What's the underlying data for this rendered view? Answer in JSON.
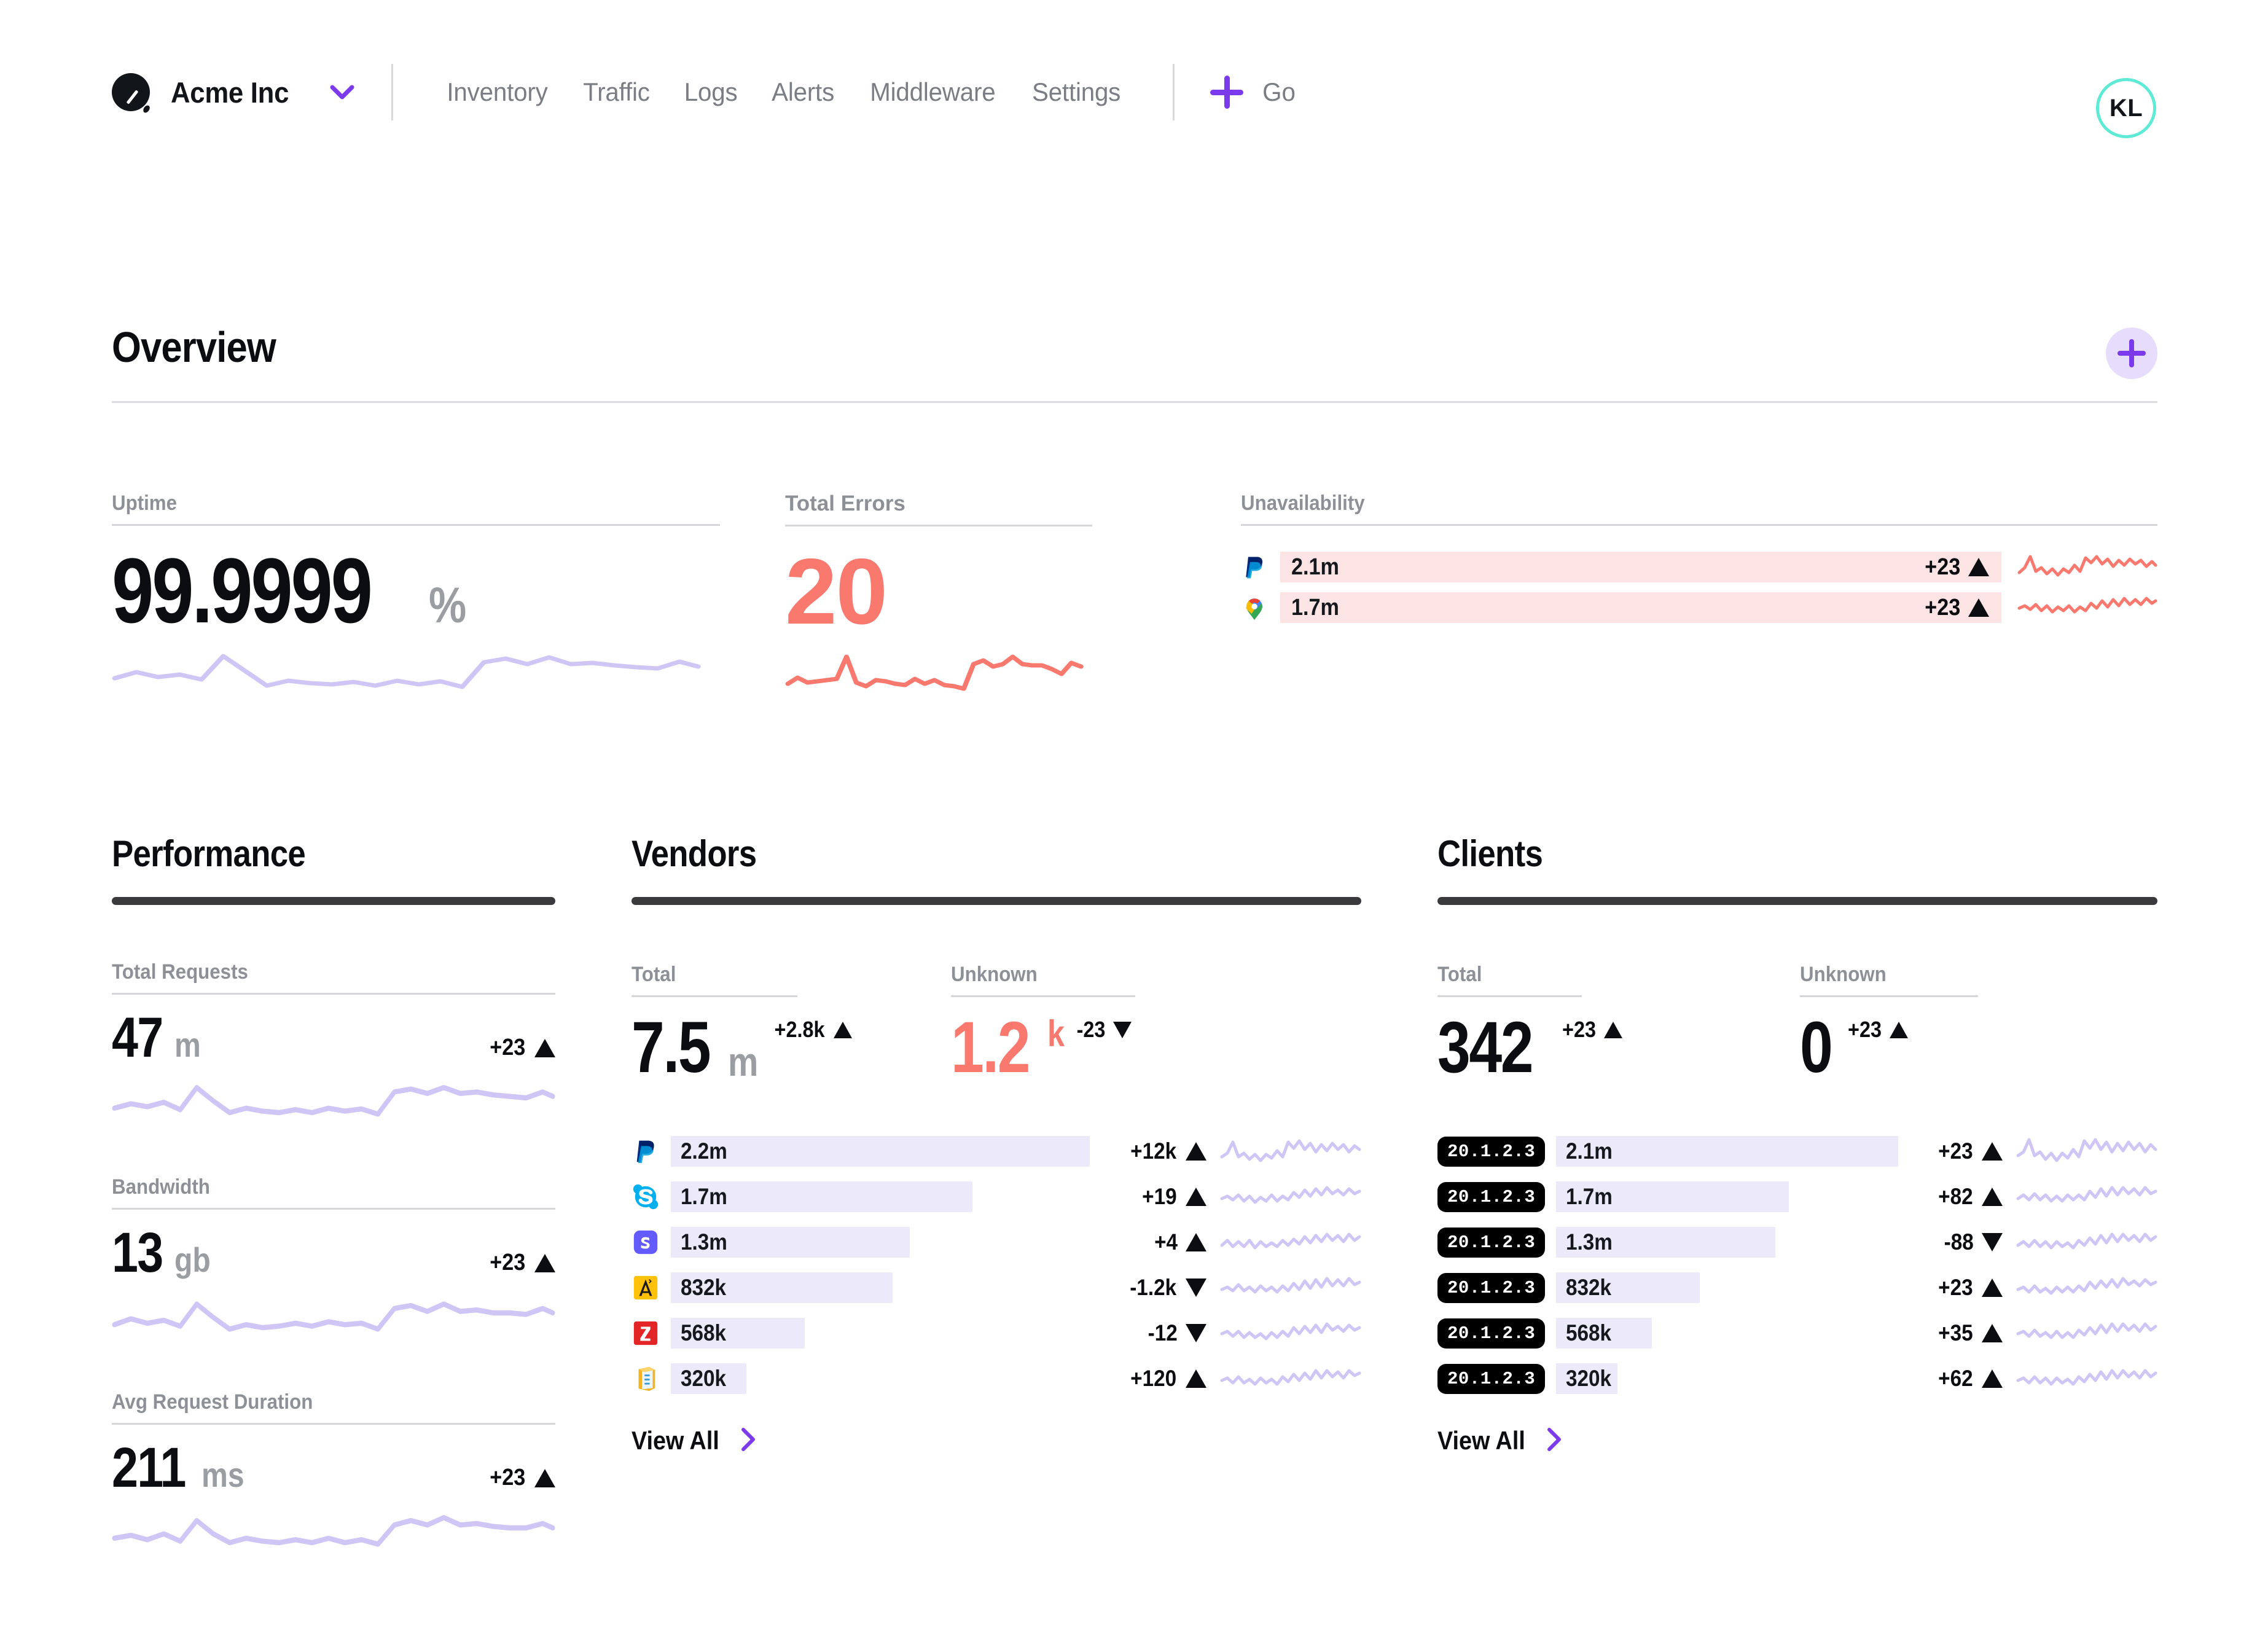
{
  "nav": {
    "org": "Acme Inc",
    "logo_icon": "dark-circle-needle-logo",
    "chevron_icon": "chevron-down-icon",
    "links": [
      "Inventory",
      "Traffic",
      "Logs",
      "Alerts",
      "Middleware",
      "Settings"
    ],
    "go_label": "Go",
    "go_icon": "plus-icon",
    "avatar_initials": "KL"
  },
  "overview": {
    "title": "Overview",
    "add_icon": "plus-icon",
    "uptime": {
      "label": "Uptime",
      "value": "99.9999",
      "unit": "%"
    },
    "errors": {
      "label": "Total Errors",
      "value": "20"
    },
    "unavailability": {
      "label": "Unavailability",
      "rows": [
        {
          "icon": "paypal-icon",
          "value": "2.1m",
          "delta": "+23",
          "dir": "up",
          "bar_pct": 100
        },
        {
          "icon": "google-maps-icon",
          "value": "1.7m",
          "delta": "+23",
          "dir": "up",
          "bar_pct": 100
        }
      ]
    }
  },
  "performance": {
    "title": "Performance",
    "metrics": [
      {
        "label": "Total Requests",
        "value": "47",
        "unit": "m",
        "delta": "+23",
        "dir": "up"
      },
      {
        "label": "Bandwidth",
        "value": "13",
        "unit": "gb",
        "delta": "+23",
        "dir": "up"
      },
      {
        "label": "Avg Request Duration",
        "value": "211",
        "unit": "ms",
        "delta": "+23",
        "dir": "up"
      }
    ]
  },
  "vendors": {
    "title": "Vendors",
    "total": {
      "label": "Total",
      "value": "7.5",
      "unit": "m",
      "delta": "+2.8k",
      "dir": "up"
    },
    "unknown": {
      "label": "Unknown",
      "value": "1.2",
      "unit": "k",
      "delta": "-23",
      "dir": "down"
    },
    "rows": [
      {
        "icon": "paypal-icon",
        "value": "2.2m",
        "delta": "+12k",
        "dir": "up",
        "bar_pct": 100
      },
      {
        "icon": "skype-icon",
        "value": "1.7m",
        "delta": "+19",
        "dir": "up",
        "bar_pct": 72
      },
      {
        "icon": "stripe-icon",
        "value": "1.3m",
        "delta": "+4",
        "dir": "up",
        "bar_pct": 57
      },
      {
        "icon": "adonis-icon",
        "value": "832k",
        "delta": "-1.2k",
        "dir": "down",
        "bar_pct": 53
      },
      {
        "icon": "zoho-icon",
        "value": "568k",
        "delta": "-12",
        "dir": "down",
        "bar_pct": 32
      },
      {
        "icon": "storybook-icon",
        "value": "320k",
        "delta": "+120",
        "dir": "up",
        "bar_pct": 18
      }
    ],
    "view_all": "View All",
    "chevron_icon": "chevron-right-icon"
  },
  "clients": {
    "title": "Clients",
    "total": {
      "label": "Total",
      "value": "342",
      "delta": "+23",
      "dir": "up"
    },
    "unknown": {
      "label": "Unknown",
      "value": "0",
      "delta": "+23",
      "dir": "up"
    },
    "rows": [
      {
        "ip": "20.1.2.3",
        "value": "2.1m",
        "delta": "+23",
        "dir": "up",
        "bar_pct": 100
      },
      {
        "ip": "20.1.2.3",
        "value": "1.7m",
        "delta": "+82",
        "dir": "up",
        "bar_pct": 68
      },
      {
        "ip": "20.1.2.3",
        "value": "1.3m",
        "delta": "-88",
        "dir": "down",
        "bar_pct": 64
      },
      {
        "ip": "20.1.2.3",
        "value": "832k",
        "delta": "+23",
        "dir": "up",
        "bar_pct": 42
      },
      {
        "ip": "20.1.2.3",
        "value": "568k",
        "delta": "+35",
        "dir": "up",
        "bar_pct": 28
      },
      {
        "ip": "20.1.2.3",
        "value": "320k",
        "delta": "+62",
        "dir": "up",
        "bar_pct": 18
      }
    ],
    "view_all": "View All",
    "chevron_icon": "chevron-right-icon"
  },
  "colors": {
    "accent": "#7c3aed",
    "accent_soft": "#e6ddfd",
    "danger": "#f9796f",
    "danger_soft": "#fce4e4",
    "spark_purple": "#cfc6f5",
    "bar_purple": "#ece9fb",
    "teal": "#5eead4",
    "text": "#0b0d10",
    "muted": "#8d9096"
  },
  "chart_data": [
    {
      "type": "line",
      "title": "Uptime sparkline",
      "ylabel": "",
      "xlabel": "",
      "series": [
        {
          "name": "uptime",
          "values": [
            30,
            42,
            35,
            38,
            33,
            66,
            46,
            22,
            30,
            26,
            24,
            28,
            22,
            30,
            24,
            29,
            20,
            55,
            60,
            52,
            62,
            52,
            54,
            50,
            48,
            46,
            56,
            48
          ]
        }
      ],
      "color": "#cfc6f5"
    },
    {
      "type": "line",
      "title": "Total Errors sparkline",
      "ylabel": "",
      "xlabel": "",
      "series": [
        {
          "name": "errors",
          "values": [
            18,
            30,
            22,
            24,
            26,
            28,
            62,
            20,
            14,
            24,
            22,
            18,
            16,
            26,
            18,
            24,
            16,
            14,
            12,
            50,
            56,
            46,
            50,
            62,
            50,
            48,
            48,
            42,
            34,
            52,
            46
          ]
        }
      ],
      "color": "#f9796f"
    }
  ]
}
